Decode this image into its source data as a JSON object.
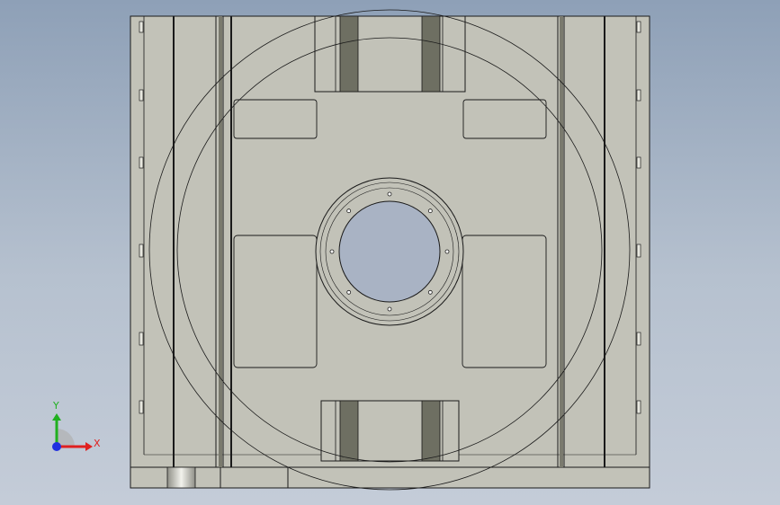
{
  "view": {
    "background_top": "#8ea0b7",
    "background_bottom": "#c4ccd8",
    "part_fill": "#c2c2b8",
    "edge_color": "#1a1a1a",
    "dark_strip_color": "#6e6f62"
  },
  "triad": {
    "icon": "coordinate-triad-icon",
    "x_label": "X",
    "y_label": "Y",
    "x_color": "#e02020",
    "y_color": "#20b020",
    "z_color": "#2030e0"
  }
}
